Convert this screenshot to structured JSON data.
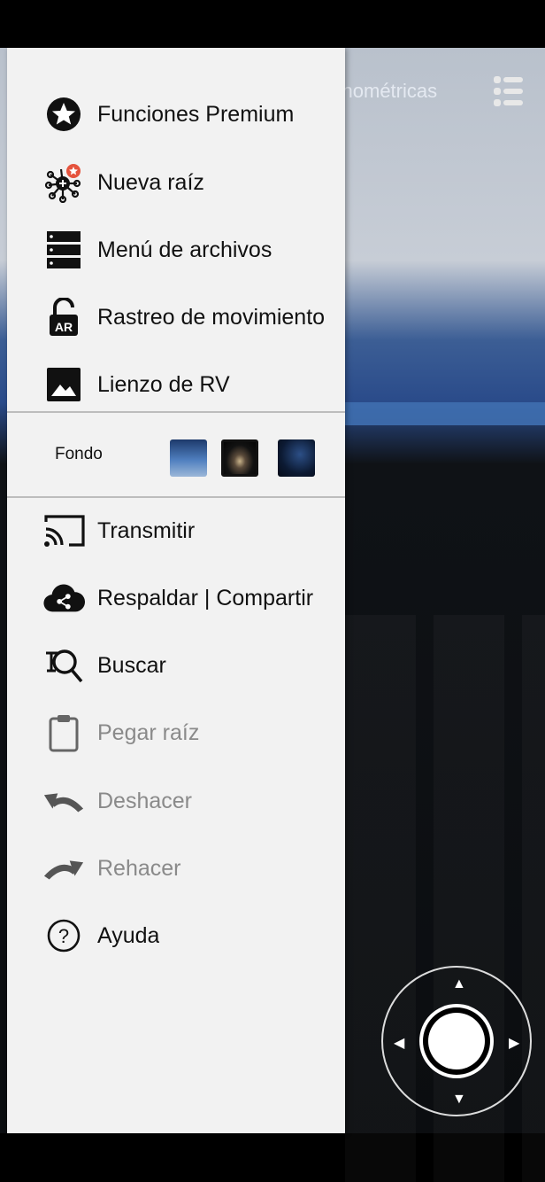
{
  "ar": {
    "title": "Funciones Trigonométricas"
  },
  "drawer": {
    "items_top": [
      {
        "label": "Funciones Premium",
        "icon": "star-circle-icon"
      },
      {
        "label": "Nueva raíz",
        "icon": "new-root-icon"
      },
      {
        "label": "Menú de archivos",
        "icon": "file-menu-icon"
      },
      {
        "label": "Rastreo de movimiento",
        "icon": "ar-lock-icon"
      },
      {
        "label": "Lienzo de RV",
        "icon": "image-icon"
      }
    ],
    "background": {
      "label": "Fondo",
      "options": [
        "ocean",
        "galaxy",
        "night"
      ],
      "selected": "galaxy"
    },
    "items_bottom": [
      {
        "label": "Transmitir",
        "icon": "cast-icon",
        "enabled": true
      },
      {
        "label": "Respaldar | Compartir",
        "icon": "cloud-share-icon",
        "enabled": true
      },
      {
        "label": "Buscar",
        "icon": "search-icon",
        "enabled": true
      },
      {
        "label": "Pegar raíz",
        "icon": "clipboard-icon",
        "enabled": false
      },
      {
        "label": "Deshacer",
        "icon": "undo-icon",
        "enabled": false
      },
      {
        "label": "Rehacer",
        "icon": "redo-icon",
        "enabled": false
      },
      {
        "label": "Ayuda",
        "icon": "help-icon",
        "enabled": true
      }
    ]
  }
}
